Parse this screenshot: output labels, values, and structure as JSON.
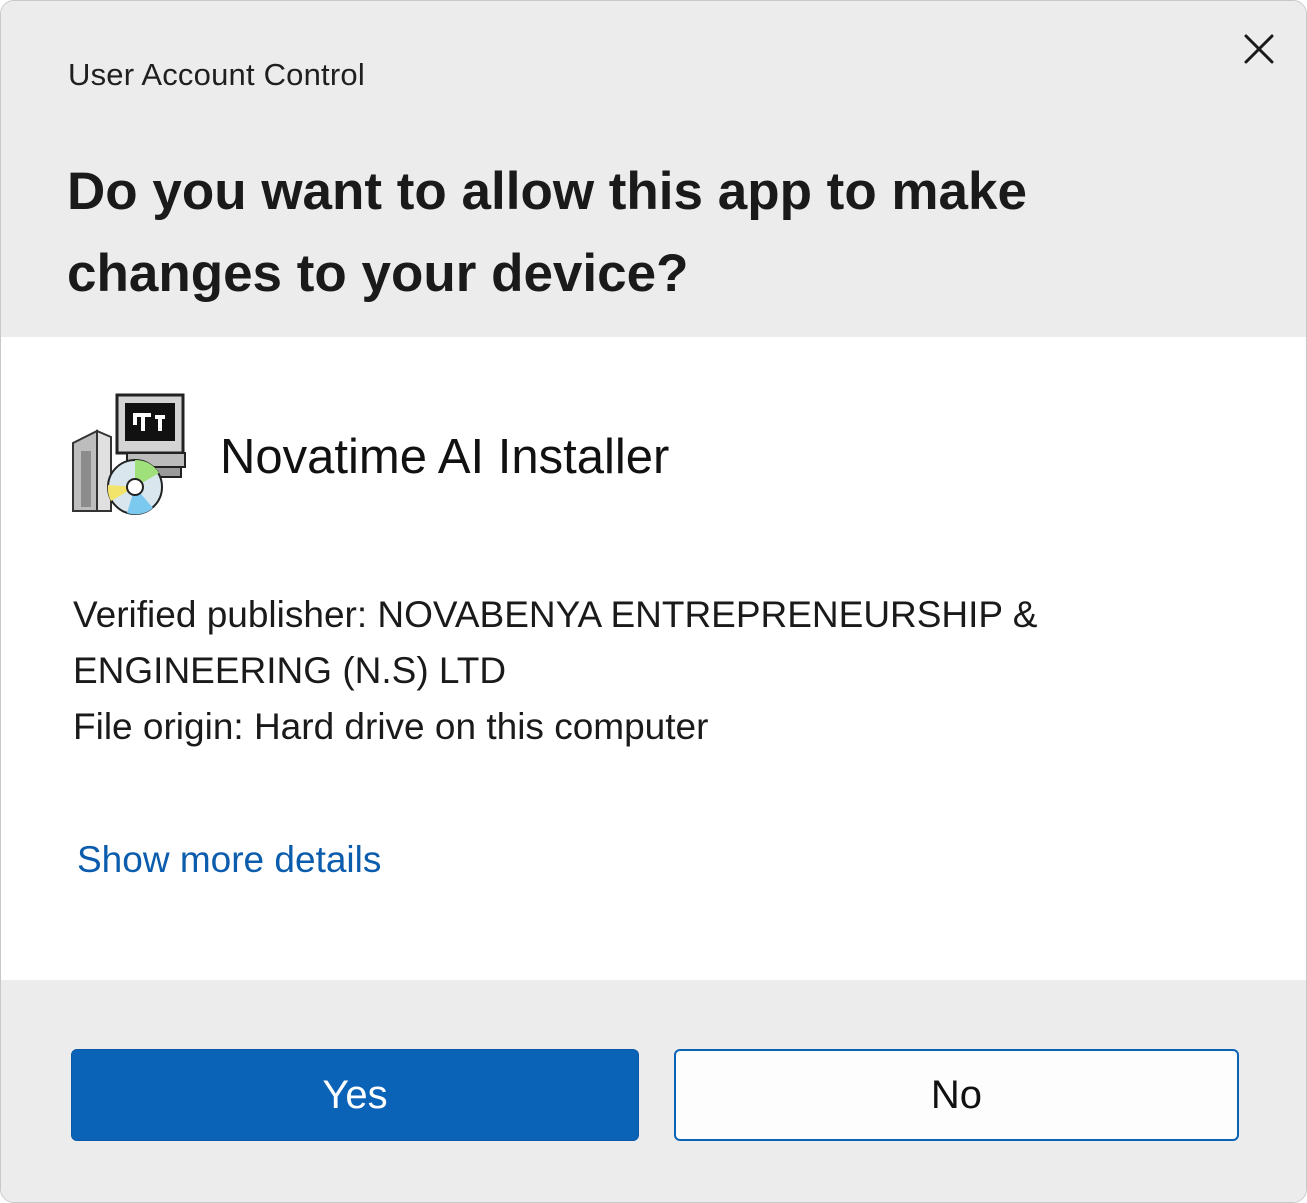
{
  "dialog": {
    "caption": "User Account Control",
    "question": "Do you want to allow this app to make changes to your device?",
    "close_icon": "close-icon"
  },
  "app": {
    "icon": "installer-package-icon",
    "name": "Novatime AI Installer"
  },
  "info": {
    "publisher_line1": "Verified publisher: NOVABENYA ENTREPRENEURSHIP &",
    "publisher_line2": "ENGINEERING (N.S) LTD",
    "file_origin": "File origin: Hard drive on this computer"
  },
  "details_link": "Show more details",
  "buttons": {
    "yes": "Yes",
    "no": "No"
  },
  "colors": {
    "accent": "#0b63b8",
    "link": "#0b5cad",
    "header_bg": "#ececec"
  }
}
